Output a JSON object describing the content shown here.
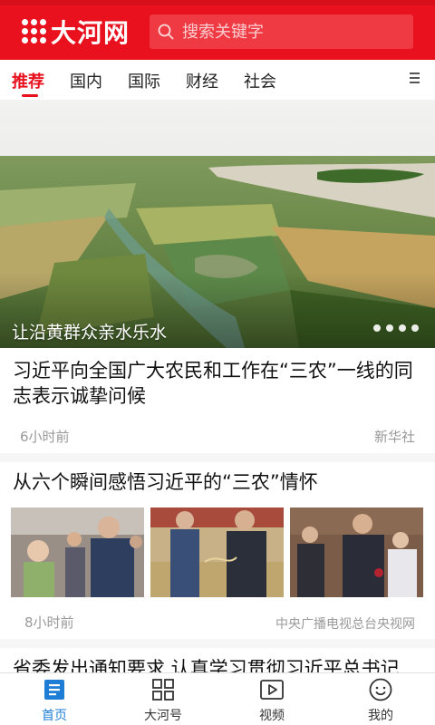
{
  "app": {
    "logo_text": "大河网",
    "brand_color": "#e8111d"
  },
  "search": {
    "placeholder": "搜索关键字"
  },
  "tabs": [
    {
      "label": "推荐",
      "active": true
    },
    {
      "label": "国内",
      "active": false
    },
    {
      "label": "国际",
      "active": false
    },
    {
      "label": "财经",
      "active": false
    },
    {
      "label": "社会",
      "active": false
    }
  ],
  "hero": {
    "caption": "让沿黄群众亲水乐水",
    "slides": 4
  },
  "articles": [
    {
      "title": "习近平向全国广大农民和工作在“三农”一线的同志表示诚挚问候",
      "time": "6小时前",
      "source": "新华社"
    },
    {
      "title": "从六个瞬间感悟习近平的“三农”情怀",
      "time": "8小时前",
      "source": "中央广播电视总台央视网"
    },
    {
      "title": "省委发出通知要求 认真学习贯彻习近平总书记"
    }
  ],
  "tabbar": [
    {
      "label": "首页",
      "icon": "home-icon",
      "active": true
    },
    {
      "label": "大河号",
      "icon": "grid-icon",
      "active": false
    },
    {
      "label": "视频",
      "icon": "video-icon",
      "active": false
    },
    {
      "label": "我的",
      "icon": "profile-icon",
      "active": false
    }
  ]
}
